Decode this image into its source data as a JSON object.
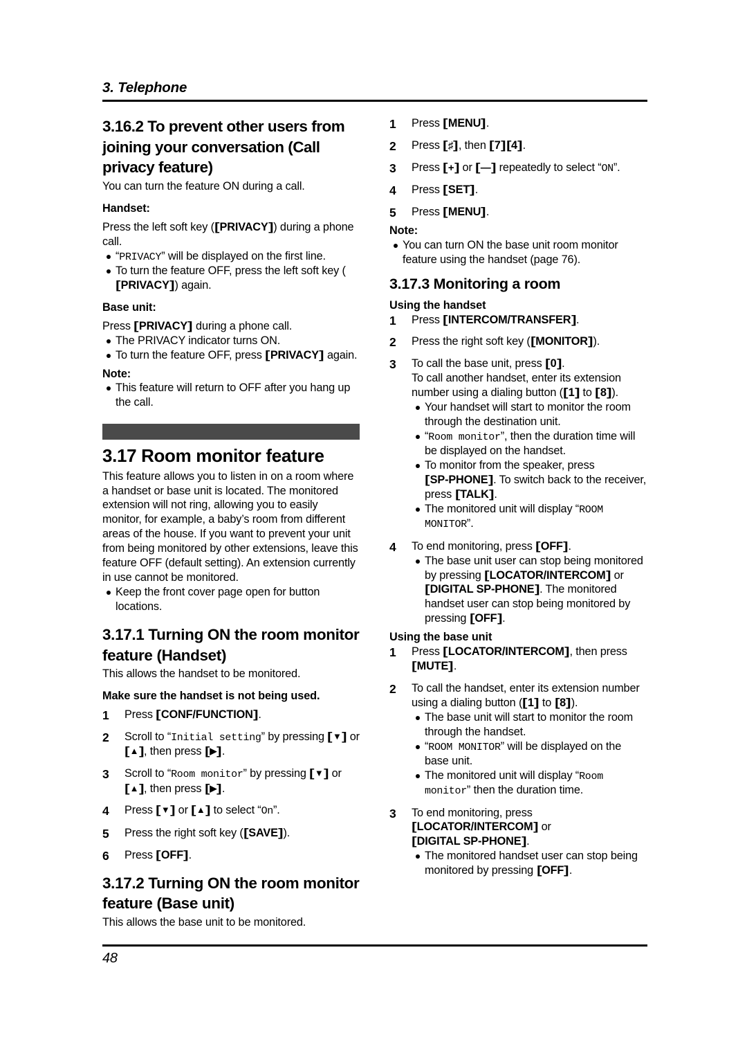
{
  "header": {
    "chapter_title": "3. Telephone"
  },
  "footer": {
    "page_number": "48"
  },
  "left_column": {
    "section_3_16_2": {
      "heading": "3.16.2 To prevent other users from joining your conversation (Call privacy feature)",
      "intro": "You can turn the feature ON during a call.",
      "handset_label": "Handset:",
      "handset_instruction_pre": "Press the left soft key (",
      "handset_key": "PRIVACY",
      "handset_instruction_post": ") during a phone call.",
      "handset_bullets": [
        {
          "pre": "“",
          "lcd": "PRIVACY",
          "post": "” will be displayed on the first line."
        },
        {
          "pre": "To turn the feature OFF, press the left soft key (",
          "key": "PRIVACY",
          "post": ") again."
        }
      ],
      "base_unit_label": "Base unit:",
      "base_unit_instruction_pre": "Press ",
      "base_unit_key": "PRIVACY",
      "base_unit_instruction_post": " during a phone call.",
      "base_unit_bullets": [
        {
          "text": "The PRIVACY indicator turns ON."
        },
        {
          "pre": "To turn the feature OFF, press ",
          "key": "PRIVACY",
          "post": " again."
        }
      ],
      "note_label": "Note:",
      "note_bullets": [
        {
          "text": "This feature will return to OFF after you hang up the call."
        }
      ]
    },
    "section_3_17": {
      "heading": "3.17 Room monitor feature",
      "body": "This feature allows you to listen in on a room where a handset or base unit is located. The monitored extension will not ring, allowing you to easily monitor, for example, a baby’s room from different areas of the house. If you want to prevent your unit from being monitored by other extensions, leave this feature OFF (default setting). An extension currently in use cannot be monitored.",
      "bullets": [
        {
          "text": "Keep the front cover page open for button locations."
        }
      ],
      "divider_color": "#4a4a4a"
    },
    "section_3_17_1": {
      "heading": "3.17.1 Turning ON the room monitor feature (Handset)",
      "intro": "This allows the handset to be monitored.",
      "precondition": "Make sure the handset is not being used.",
      "steps": [
        {
          "num": "1",
          "pre": "Press ",
          "key": "CONF/FUNCTION",
          "post": "."
        },
        {
          "num": "2",
          "pre": "Scroll to “",
          "lcd": "Initial setting",
          "mid": "” by pressing ",
          "key_down": "▼",
          "mid2": " or ",
          "key_up": "▲",
          "mid3": ", then press ",
          "key_right": "▶",
          "post": "."
        },
        {
          "num": "3",
          "pre": "Scroll to “",
          "lcd": "Room monitor",
          "mid": "” by pressing ",
          "key_down": "▼",
          "mid2": " or ",
          "key_up": "▲",
          "mid3": ", then press ",
          "key_right": "▶",
          "post": "."
        },
        {
          "num": "4",
          "pre": "Press ",
          "key_down": "▼",
          "mid2": " or ",
          "key_up": "▲",
          "mid3": " to select “",
          "lcd": "On",
          "post": "”."
        },
        {
          "num": "5",
          "pre": "Press the right soft key (",
          "key": "SAVE",
          "post": ")."
        },
        {
          "num": "6",
          "pre": "Press ",
          "key": "OFF",
          "post": "."
        }
      ]
    },
    "section_3_17_2": {
      "heading": "3.17.2 Turning ON the room monitor feature (Base unit)",
      "intro": "This allows the base unit to be monitored."
    }
  },
  "right_column": {
    "base_unit_steps": [
      {
        "num": "1",
        "pre": "Press ",
        "key": "MENU",
        "post": "."
      },
      {
        "num": "2",
        "pre": "Press ",
        "key": "♯",
        "mid": ", then ",
        "key2": "7",
        "key3": "4",
        "post": "."
      },
      {
        "num": "3",
        "pre": "Press ",
        "key": "+",
        "mid": " or ",
        "key2": "—",
        "mid2": " repeatedly to select “",
        "lcd": "ON",
        "post": "”."
      },
      {
        "num": "4",
        "pre": "Press ",
        "key": "SET",
        "post": "."
      },
      {
        "num": "5",
        "pre": "Press ",
        "key": "MENU",
        "post": "."
      }
    ],
    "note_label": "Note:",
    "note_bullets": [
      {
        "text": "You can turn ON the base unit room monitor feature using the handset (page 76)."
      }
    ],
    "section_3_17_3": {
      "heading": "3.17.3 Monitoring a room",
      "using_handset_label": "Using the handset",
      "handset_steps": [
        {
          "num": "1",
          "pre": "Press ",
          "key": "INTERCOM/TRANSFER",
          "post": "."
        },
        {
          "num": "2",
          "pre": "Press the right soft key (",
          "key": "MONITOR",
          "post": ")."
        },
        {
          "num": "3",
          "line1_pre": "To call the base unit, press ",
          "line1_key": "0",
          "line1_post": ".",
          "line2_pre": "To call another handset, enter its extension number using a dialing button (",
          "line2_key": "1",
          "line2_mid": " to ",
          "line2_key2": "8",
          "line2_post": ").",
          "bullets": [
            {
              "text": "Your handset will start to monitor the room through the destination unit."
            },
            {
              "pre": "“",
              "lcd": "Room monitor",
              "post": "”, then the duration time will be displayed on the handset."
            },
            {
              "pre": "To monitor from the speaker, press ",
              "key": "SP-PHONE",
              "mid": ". To switch back to the receiver, press ",
              "key2": "TALK",
              "post": "."
            },
            {
              "pre": "The monitored unit will display “",
              "lcd": "ROOM MONITOR",
              "post": "”."
            }
          ]
        },
        {
          "num": "4",
          "line1_pre": "To end monitoring, press ",
          "line1_key": "OFF",
          "line1_post": ".",
          "bullets": [
            {
              "pre": "The base unit user can stop being monitored by pressing ",
              "key": "LOCATOR/INTERCOM",
              "mid": " or ",
              "key2": "DIGITAL SP-PHONE",
              "mid2": ". The monitored handset user can stop being monitored by pressing ",
              "key3": "OFF",
              "post": "."
            }
          ]
        }
      ],
      "using_base_unit_label": "Using the base unit",
      "base_unit_steps": [
        {
          "num": "1",
          "pre": "Press ",
          "key": "LOCATOR/INTERCOM",
          "mid": ", then press ",
          "key2": "MUTE",
          "post": "."
        },
        {
          "num": "2",
          "line1_pre": "To call the handset, enter its extension number using a dialing button (",
          "line1_key": "1",
          "line1_mid": " to ",
          "line1_key2": "8",
          "line1_post": ").",
          "bullets": [
            {
              "text": "The base unit will start to monitor the room through the handset."
            },
            {
              "pre": "“",
              "lcd": "ROOM MONITOR",
              "post": "” will be displayed on the base unit."
            },
            {
              "pre": "The monitored unit will display “",
              "lcd": "Room monitor",
              "post": "” then the duration time."
            }
          ]
        },
        {
          "num": "3",
          "line1_pre": "To end monitoring, press ",
          "line1_key": "LOCATOR/INTERCOM",
          "line1_mid": " or ",
          "line1_key2": "DIGITAL SP-PHONE",
          "line1_post": ".",
          "bullets": [
            {
              "pre": "The monitored handset user can stop being monitored by pressing ",
              "key": "OFF",
              "post": "."
            }
          ]
        }
      ]
    }
  }
}
